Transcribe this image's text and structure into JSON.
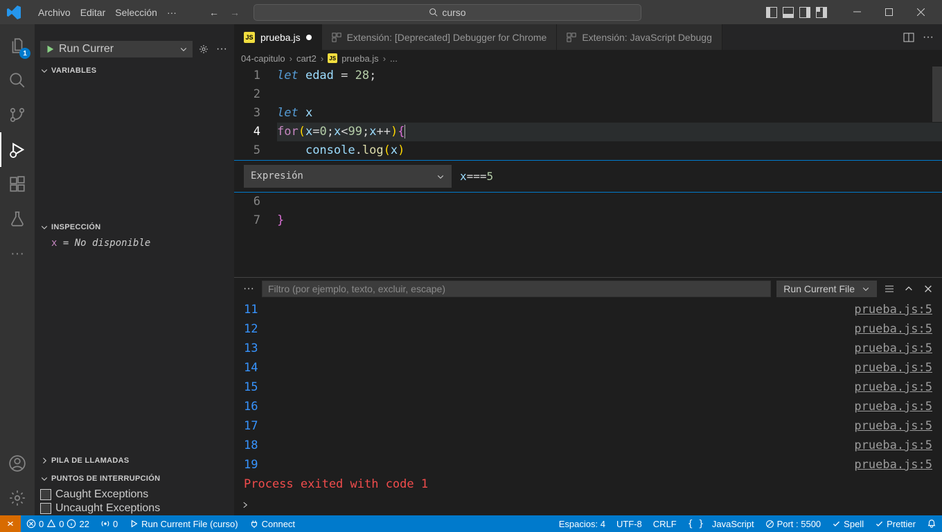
{
  "menu": {
    "file": "Archivo",
    "edit": "Editar",
    "selection": "Selección"
  },
  "search_box": {
    "value": "curso"
  },
  "activity_badge": "1",
  "debug_sidebar": {
    "run_config_label": "Run Currer",
    "sections": {
      "variables": "VARIABLES",
      "watch": "INSPECCIÓN",
      "callstack": "PILA DE LLAMADAS",
      "breakpoints": "PUNTOS DE INTERRUPCIÓN"
    },
    "watch_expr": {
      "var": "x",
      "eq": " = ",
      "value": "No disponible"
    },
    "breakpoints": {
      "caught": "Caught Exceptions",
      "uncaught": "Uncaught Exceptions"
    }
  },
  "tabs": {
    "t1": "prueba.js",
    "t2": "Extensión: [Deprecated] Debugger for Chrome",
    "t3": "Extensión: JavaScript Debugg"
  },
  "breadcrumbs": {
    "a": "04-capitulo",
    "b": "cart2",
    "c": "prueba.js",
    "d": "..."
  },
  "code": {
    "l1_let": "let ",
    "l1_id": "edad",
    "l1_sp": " ",
    "l1_eq": "=",
    "l1_sp2": " ",
    "l1_num": "28",
    "l1_sc": ";",
    "l3_let": "let ",
    "l3_id": "x",
    "l4_for": "for",
    "l4_open": "(",
    "l4_x": "x",
    "l4_eq": "=",
    "l4_z": "0",
    "l4_sc1": ";",
    "l4_x2": "x",
    "l4_lt": "<",
    "l4_n99": "99",
    "l4_sc2": ";",
    "l4_x3": "x",
    "l4_pp": "++",
    "l4_close": ")",
    "l4_brace": "{",
    "l5_ind": "    ",
    "l5_con": "console",
    "l5_dot": ".",
    "l5_log": "log",
    "l5_op": "(",
    "l5_x": "x",
    "l5_cl": ")",
    "l7_brace": "}",
    "lines": {
      "l1": "1",
      "l2": "2",
      "l3": "3",
      "l4": "4",
      "l5": "5",
      "l6": "6",
      "l7": "7"
    }
  },
  "break_widget": {
    "mode": "Expresión",
    "cond_x": "x",
    "cond_eq": "===",
    "cond_v": "5"
  },
  "panel": {
    "filter_placeholder": "Filtro (por ejemplo, texto, excluir, escape)",
    "select_label": "Run Current File",
    "console_numbers": [
      "11",
      "12",
      "13",
      "14",
      "15",
      "16",
      "17",
      "18",
      "19"
    ],
    "source_link": "prueba.js:5",
    "exit_msg": "Process exited with code 1"
  },
  "status": {
    "errors": "0",
    "warnings": "0",
    "info": "22",
    "port_forward": "0",
    "run_label": "Run Current File (curso)",
    "connect": "Connect",
    "spaces": "Espacios: 4",
    "encoding": "UTF-8",
    "eol": "CRLF",
    "lang": "JavaScript",
    "live": "Port : 5500",
    "spell": "Spell",
    "prettier": "Prettier"
  }
}
